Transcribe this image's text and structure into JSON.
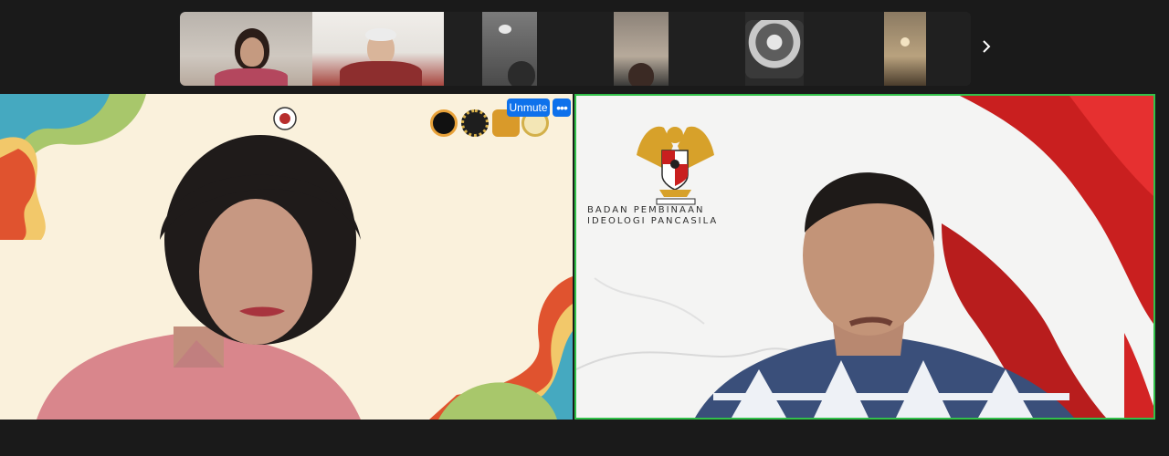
{
  "filmstrip": {
    "next_icon": "chevron-right-icon",
    "participants": [
      {
        "id": "p1"
      },
      {
        "id": "p2"
      },
      {
        "id": "p3"
      },
      {
        "id": "p4"
      },
      {
        "id": "p5"
      },
      {
        "id": "p6"
      },
      {
        "id": "p7"
      },
      {
        "id": "p8"
      },
      {
        "id": "p9"
      },
      {
        "id": "p10"
      },
      {
        "id": "p11"
      }
    ]
  },
  "main": {
    "left_video": {
      "controls": {
        "unmute_label": "Unmute",
        "more_label": "•••"
      }
    },
    "right_video": {
      "background_text_line1": "BADAN PEMBINAAN",
      "background_text_line2": "IDEOLOGI PANCASILA",
      "active_speaker_color": "#32c14a"
    }
  },
  "colors": {
    "accent": "#0e71eb",
    "app_bg": "#1a1a1a"
  }
}
